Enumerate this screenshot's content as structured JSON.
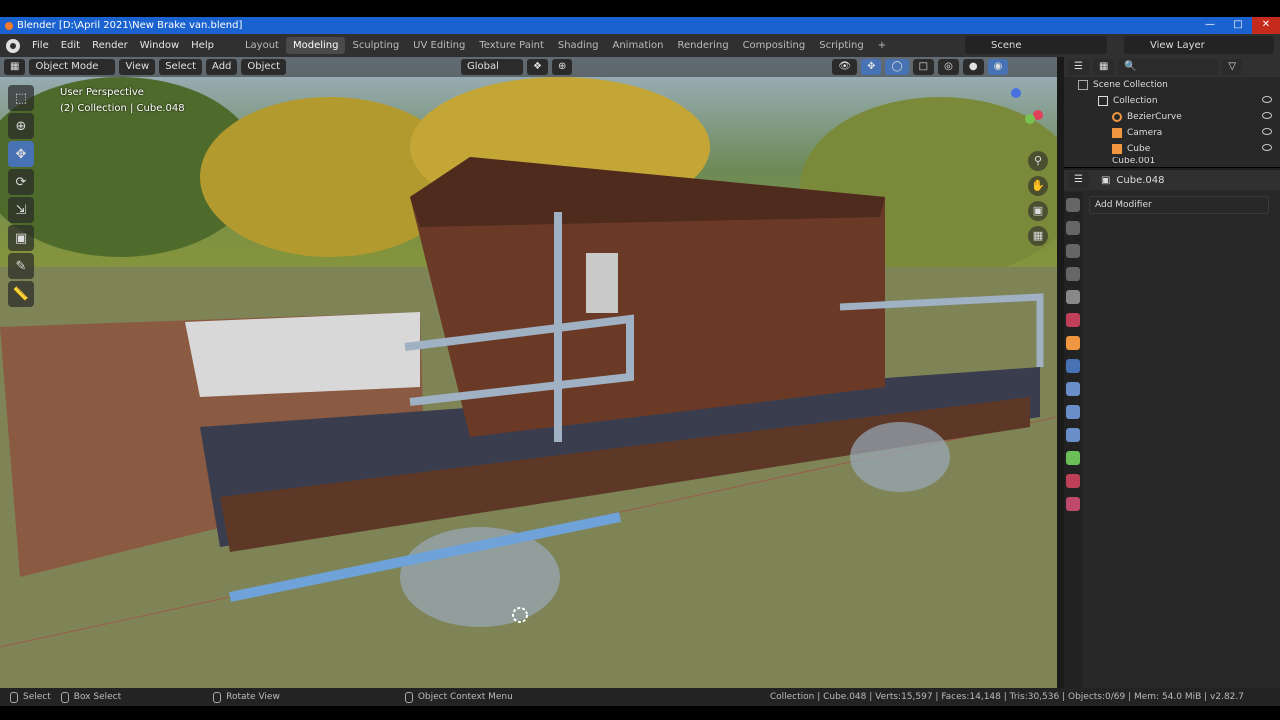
{
  "window": {
    "title": "Blender [D:\\April 2021\\New Brake van.blend]"
  },
  "menus": [
    "File",
    "Edit",
    "Render",
    "Window",
    "Help"
  ],
  "workspace_tabs": [
    "Layout",
    "Modeling",
    "Sculpting",
    "UV Editing",
    "Texture Paint",
    "Shading",
    "Animation",
    "Rendering",
    "Compositing",
    "Scripting",
    "+"
  ],
  "active_workspace": "Modeling",
  "scene": "Scene",
  "view_layer": "View Layer",
  "viewport": {
    "mode": "Object Mode",
    "menus": [
      "View",
      "Select",
      "Add",
      "Object"
    ],
    "orientation": "Global",
    "info_line1": "User Perspective",
    "info_line2": "(2) Collection | Cube.048"
  },
  "outliner": {
    "root": "Scene Collection",
    "collection": "Collection",
    "items": [
      "BezierCurve",
      "Camera",
      "Cube",
      "Cube.001"
    ]
  },
  "properties": {
    "object": "Cube.048",
    "add_modifier": "Add Modifier"
  },
  "statusbar": {
    "select": "Select",
    "box_select": "Box Select",
    "rotate": "Rotate View",
    "context_menu": "Object Context Menu",
    "stats": "Collection | Cube.048 | Verts:15,597 | Faces:14,148 | Tris:30,536 | Objects:0/69 | Mem: 54.0 MiB | v2.82.7"
  },
  "colors": {
    "accent": "#4772b3",
    "title_bar": "#1b62d1",
    "van_body": "#6a3a27"
  }
}
